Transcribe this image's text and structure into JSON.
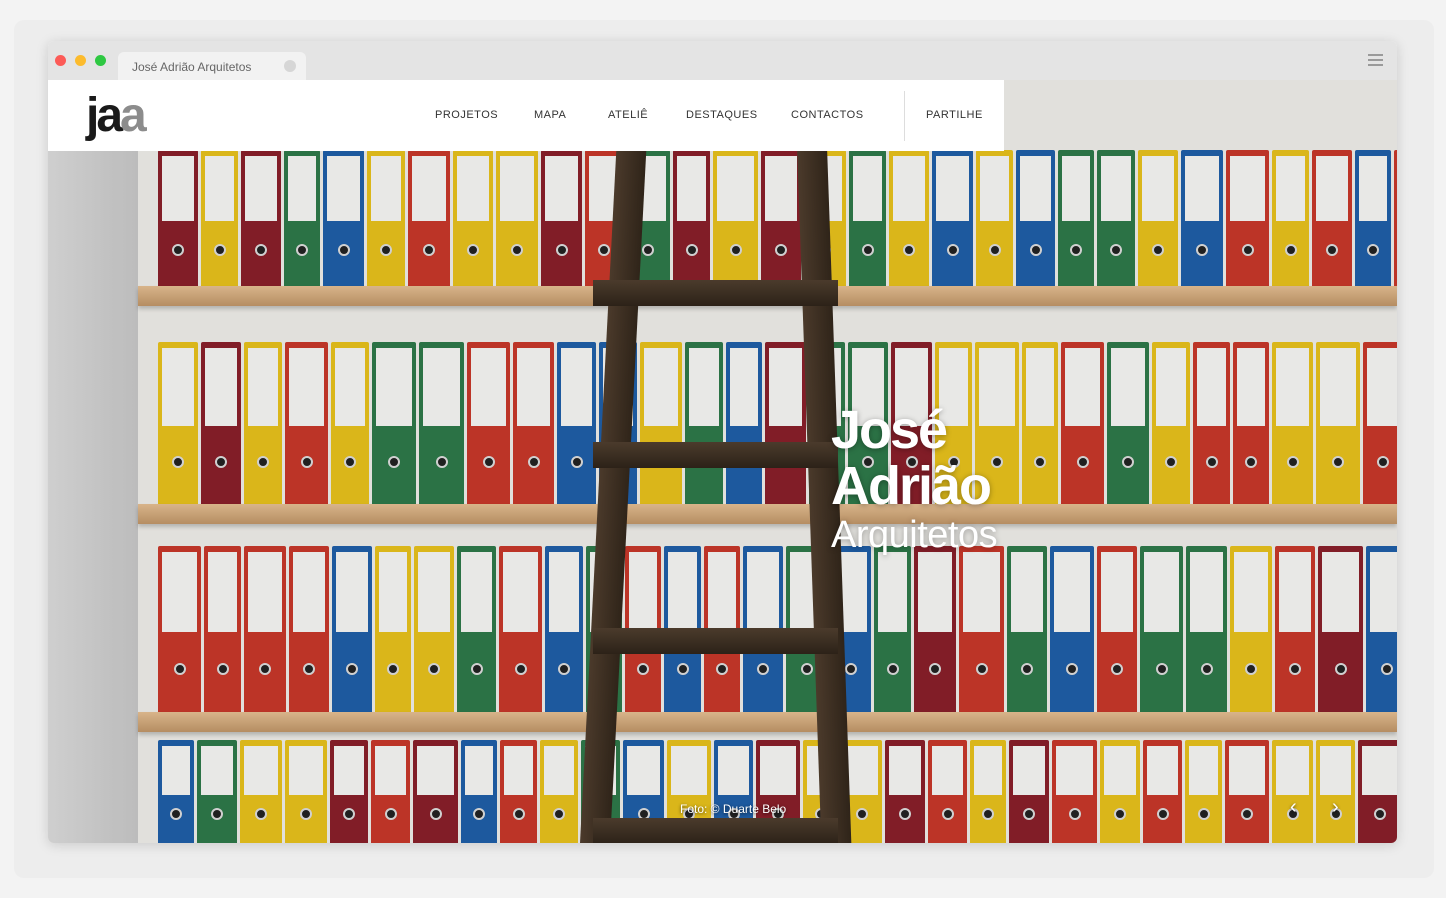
{
  "browser": {
    "tab_title": "José Adrião Arquitetos"
  },
  "site": {
    "logo": {
      "part1": "ja",
      "part2": "a"
    },
    "nav": [
      {
        "label": "PROJETOS"
      },
      {
        "label": "MAPA"
      },
      {
        "label": "ATELIÊ"
      },
      {
        "label": "DESTAQUES"
      },
      {
        "label": "CONTACTOS"
      }
    ],
    "share_label": "PARTILHE"
  },
  "hero": {
    "title_line1": "José",
    "title_line2": "Adrião",
    "title_line3": "Arquitetos",
    "photo_credit": "Foto: © Duarte Belo",
    "prev_icon": "chevron-left-icon",
    "next_icon": "chevron-right-icon"
  },
  "colors": {
    "binder_red": "#c8382a",
    "binder_yellow": "#e8c21c",
    "binder_blue": "#1f5fa8",
    "binder_maroon": "#8a1f2a",
    "binder_green": "#2e7a4a"
  }
}
